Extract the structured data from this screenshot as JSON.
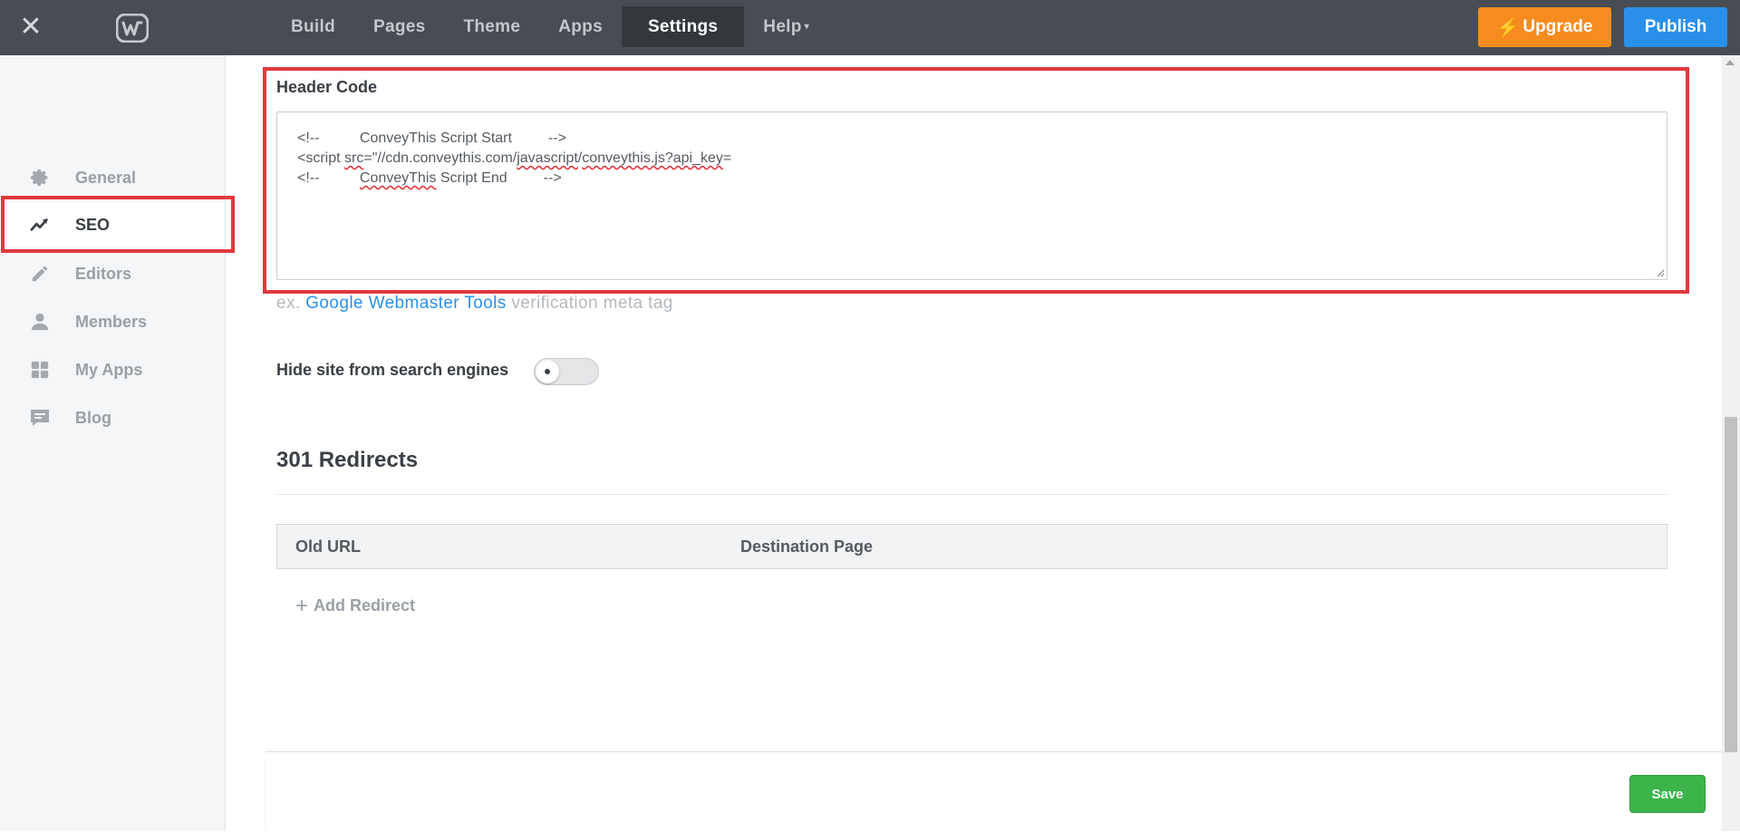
{
  "topbar": {
    "nav": [
      "Build",
      "Pages",
      "Theme",
      "Apps",
      "Settings",
      "Help"
    ],
    "active_nav": "Settings",
    "upgrade_label": "Upgrade",
    "publish_label": "Publish",
    "colors": {
      "bar": "#474d53",
      "upgrade": "#f68c1f",
      "publish": "#2990ea"
    }
  },
  "sidebar": {
    "items": [
      {
        "label": "General",
        "icon": "gear-icon"
      },
      {
        "label": "SEO",
        "icon": "trend-icon",
        "active": true
      },
      {
        "label": "Editors",
        "icon": "pencil-icon"
      },
      {
        "label": "Members",
        "icon": "person-icon"
      },
      {
        "label": "My Apps",
        "icon": "grid-icon"
      },
      {
        "label": "Blog",
        "icon": "comment-icon"
      }
    ]
  },
  "seo": {
    "header_code_label": "Header Code",
    "header_code": {
      "line1_prefix": "<!--          ConveyThis Script Start         -->",
      "line2_a": "<script ",
      "line2_src": "src",
      "line2_b": "=\"//cdn.conveythis.com/",
      "line2_js": "javascript",
      "line2_c": "/",
      "line2_file": "conveythis.js?api_key",
      "line2_d": "=",
      "line3_a": "<!--          ",
      "line3_word": "ConveyThis",
      "line3_b": " Script End         -->"
    },
    "hint_prefix": "ex. ",
    "hint_link": "Google Webmaster Tools",
    "hint_suffix": " verification meta tag",
    "hide_label": "Hide site from search engines",
    "hide_enabled": false,
    "redirects_title": "301 Redirects",
    "columns": [
      "Old URL",
      "Destination Page"
    ],
    "add_redirect_label": "Add Redirect",
    "save_label": "Save"
  }
}
